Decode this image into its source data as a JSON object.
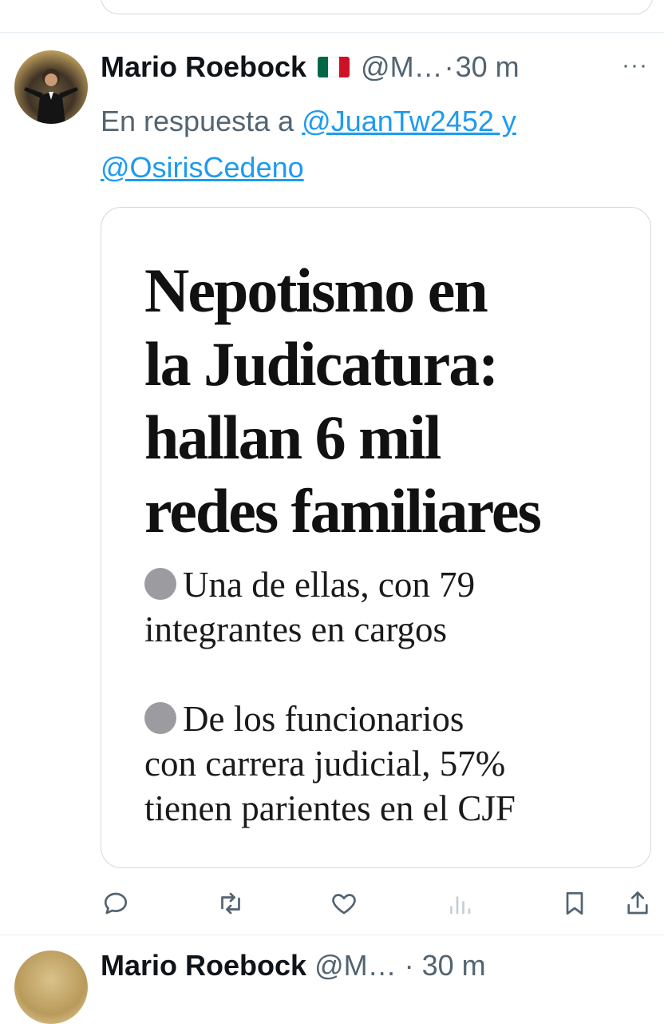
{
  "tweet": {
    "author_name": "Mario Roebock",
    "handle": "@M…",
    "separator": "·",
    "time": "30 m",
    "more": "···",
    "reply_prefix": "En respuesta a",
    "reply_to_1": "@JuanTw2452 y",
    "reply_to_2": "@OsirisCedeno",
    "image": {
      "headline_lines": [
        "Nepotismo en",
        "la Judicatura:",
        "hallan 6 mil",
        "redes familiares"
      ],
      "bullet_1": [
        "Una de ellas, con 79",
        "integrantes en cargos"
      ],
      "bullet_2": [
        "De los funcionarios",
        "con carrera judicial, 57%",
        "tienen parientes en el CJF"
      ]
    },
    "actions": [
      "reply-icon",
      "retweet-icon",
      "like-icon",
      "views-icon",
      "bookmark-icon",
      "share-icon"
    ]
  },
  "next_tweet": {
    "author_name": "Mario Roebock",
    "handle": "@M…",
    "separator": "·",
    "time": "30 m"
  },
  "colors": {
    "accent": "#1d9bf0",
    "secondary_text": "#536471",
    "border": "#cfd9de",
    "flag": [
      "#006847",
      "#ffffff",
      "#ce1126"
    ]
  }
}
